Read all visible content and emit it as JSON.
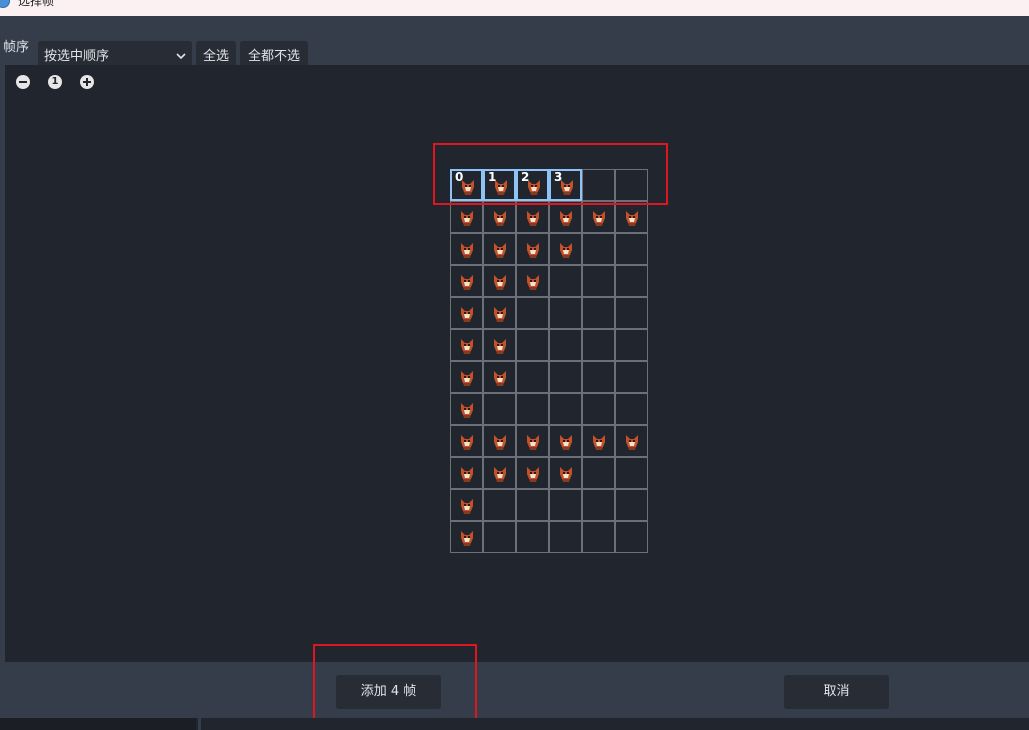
{
  "window": {
    "title": "选择帧"
  },
  "toolbar": {
    "frame_order_label": "帧序",
    "order_dropdown_value": "按选中顺序",
    "select_all_label": "全选",
    "deselect_all_label": "全都不选"
  },
  "zoom": {
    "zoom_out_icon": "minus-circle-icon",
    "reset_label": "1",
    "zoom_in_icon": "plus-circle-icon"
  },
  "frame_grid": {
    "columns": 6,
    "rows": 12,
    "selected_labels": [
      "0",
      "1",
      "2",
      "3"
    ],
    "sprite_counts_per_row": [
      4,
      6,
      4,
      3,
      2,
      2,
      2,
      1,
      6,
      4,
      1,
      1
    ]
  },
  "footer": {
    "add_label": "添加 4 帧",
    "cancel_label": "取消"
  },
  "colors": {
    "accent_selection": "#8fc3f5",
    "annotation_box": "#e0151e",
    "panel_bg": "#21252d",
    "toolbar_bg": "#363d4a"
  }
}
